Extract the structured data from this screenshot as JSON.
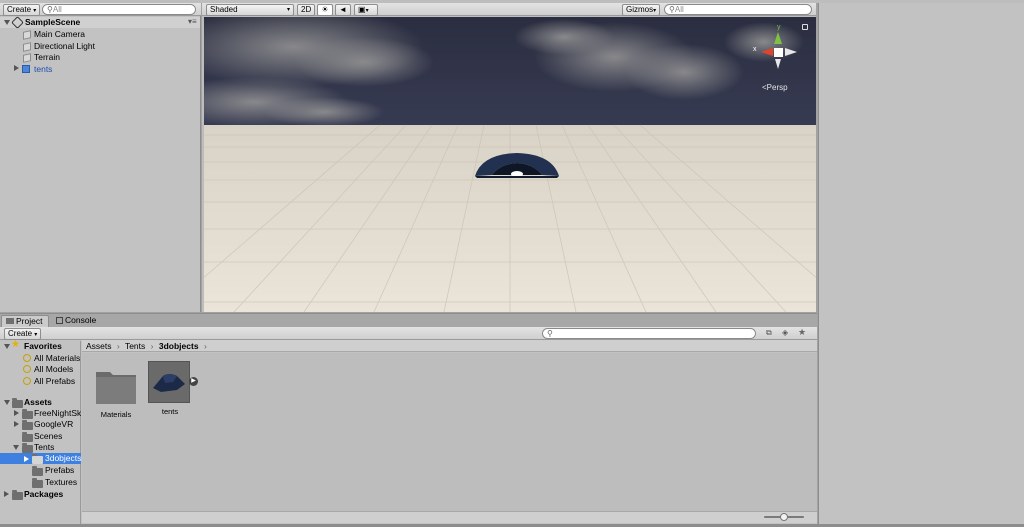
{
  "hierarchy": {
    "create_label": "Create",
    "search_placeholder": "All",
    "scene_name": "SampleScene",
    "items": [
      {
        "label": "Main Camera"
      },
      {
        "label": "Directional Light"
      },
      {
        "label": "Terrain"
      },
      {
        "label": "tents"
      }
    ]
  },
  "scene_view": {
    "shading_mode": "Shaded",
    "mode_2d": "2D",
    "gizmos_label": "Gizmos",
    "search_placeholder": "All",
    "gizmo_y": "y",
    "gizmo_x": "x",
    "projection": "Persp"
  },
  "project": {
    "tabs": [
      {
        "label": "Project"
      },
      {
        "label": "Console"
      }
    ],
    "create_label": "Create",
    "favorites": {
      "label": "Favorites",
      "items": [
        {
          "label": "All Materials"
        },
        {
          "label": "All Models"
        },
        {
          "label": "All Prefabs"
        }
      ]
    },
    "assets": {
      "label": "Assets",
      "items": [
        {
          "label": "FreeNightSky"
        },
        {
          "label": "GoogleVR"
        },
        {
          "label": "Scenes"
        },
        {
          "label": "Tents"
        },
        {
          "label": "3dobjects"
        },
        {
          "label": "Prefabs"
        },
        {
          "label": "Textures"
        }
      ]
    },
    "packages_label": "Packages",
    "breadcrumb": [
      "Assets",
      "Tents",
      "3dobjects"
    ],
    "grid_items": [
      {
        "label": "Materials"
      },
      {
        "label": "tents"
      }
    ],
    "zoom_level": 0.5
  },
  "colors": {
    "accent_selection": "#3d80df",
    "sky": "#2f3245",
    "ground": "#e9e3d6",
    "tent": "#22314f"
  }
}
